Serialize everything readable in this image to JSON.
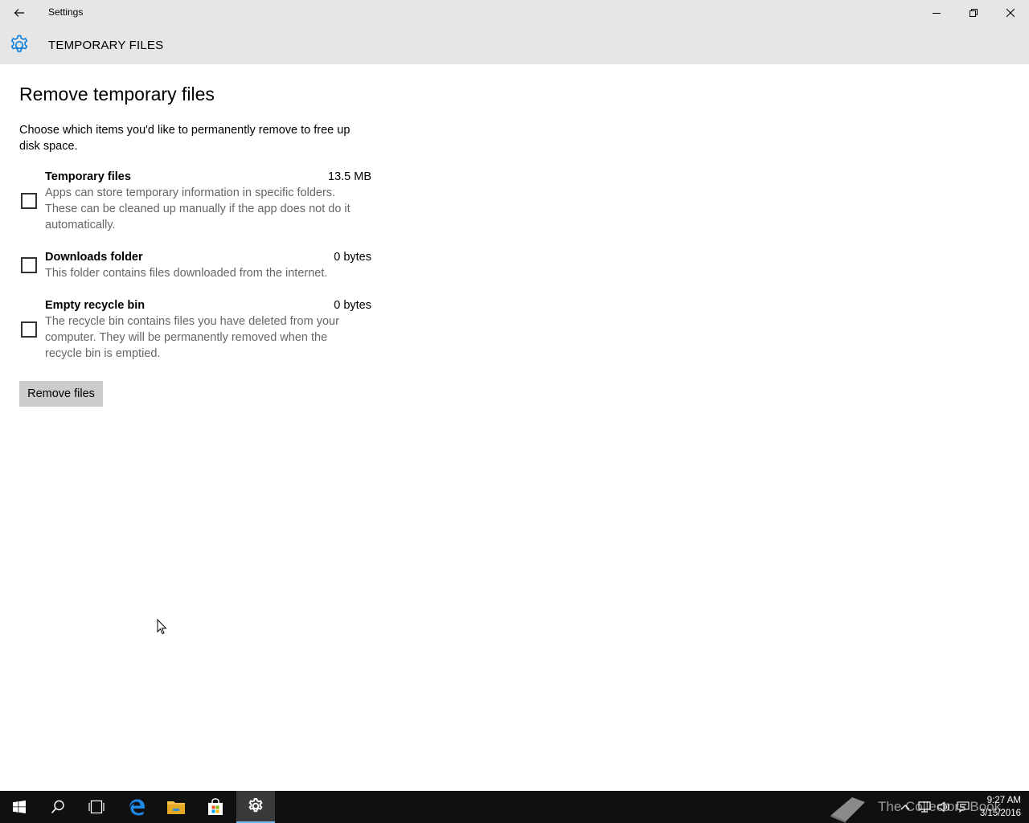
{
  "window": {
    "title": "Settings",
    "controls": [
      "minimize",
      "restore",
      "close"
    ]
  },
  "header": {
    "icon": "gear-icon",
    "title": "TEMPORARY FILES"
  },
  "main": {
    "title": "Remove temporary files",
    "description": "Choose which items you'd like to permanently remove to free up disk space.",
    "items": [
      {
        "name": "Temporary files",
        "size": "13.5 MB",
        "description": "Apps can store temporary information in specific folders. These can be cleaned up manually if the app does not do it automatically.",
        "checked": false
      },
      {
        "name": "Downloads folder",
        "size": "0 bytes",
        "description": "This folder contains files downloaded from the internet.",
        "checked": false
      },
      {
        "name": "Empty recycle bin",
        "size": "0 bytes",
        "description": "The recycle bin contains files you have deleted from your computer. They will be permanently removed when the recycle bin is emptied.",
        "checked": false
      }
    ],
    "remove_button_label": "Remove files"
  },
  "taskbar": {
    "buttons": [
      "windows-start-icon",
      "search-icon",
      "task-view-icon",
      "edge-browser-icon",
      "file-explorer-icon",
      "store-icon",
      "settings-gear-icon"
    ],
    "active": "settings-gear-icon",
    "watermark": "The Collectors Book",
    "tray": [
      "chevron-up-icon",
      "network-icon",
      "volume-icon",
      "action-center-icon"
    ],
    "time": "9:27 AM",
    "date": "3/15/2016"
  },
  "colors": {
    "accent": "#0078d7",
    "header_bg": "#e6e6e6",
    "taskbar_bg": "#101010",
    "button_bg": "#cccccc",
    "secondary_text": "#666666"
  }
}
